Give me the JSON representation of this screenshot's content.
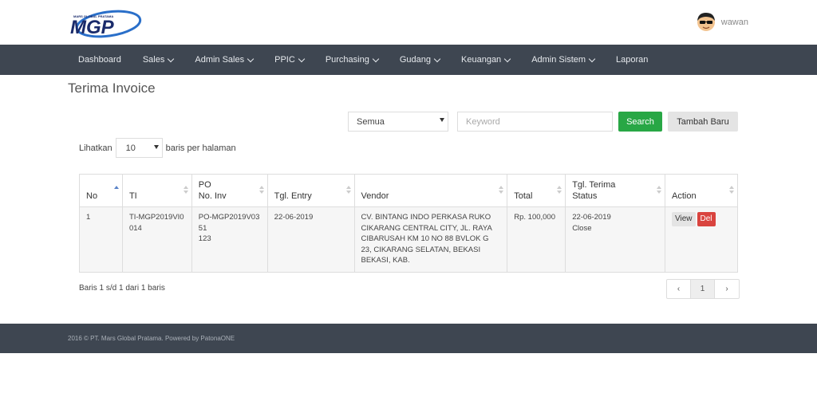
{
  "header": {
    "user_name": "wawan"
  },
  "nav": {
    "items": [
      {
        "label": "Dashboard",
        "dropdown": false
      },
      {
        "label": "Sales",
        "dropdown": true
      },
      {
        "label": "Admin Sales",
        "dropdown": true
      },
      {
        "label": "PPIC",
        "dropdown": true
      },
      {
        "label": "Purchasing",
        "dropdown": true
      },
      {
        "label": "Gudang",
        "dropdown": true
      },
      {
        "label": "Keuangan",
        "dropdown": true
      },
      {
        "label": "Admin Sistem",
        "dropdown": true
      },
      {
        "label": "Laporan",
        "dropdown": false
      }
    ]
  },
  "page": {
    "title": "Terima Invoice"
  },
  "filter": {
    "status_value": "Semua",
    "keyword_placeholder": "Keyword",
    "search_label": "Search",
    "add_label": "Tambah Baru"
  },
  "perpage": {
    "prefix": "Lihatkan",
    "value": "10",
    "suffix": "baris per halaman"
  },
  "table": {
    "columns": [
      {
        "label": "No",
        "sort_active": true
      },
      {
        "label": "TI"
      },
      {
        "label": "PO\nNo. Inv"
      },
      {
        "label": "Tgl. Entry"
      },
      {
        "label": "Vendor"
      },
      {
        "label": "Total"
      },
      {
        "label": "Tgl. Terima\nStatus"
      },
      {
        "label": "Action"
      }
    ],
    "rows": [
      {
        "no": "1",
        "ti": "TI-MGP2019VI0014",
        "po": "PO-MGP2019V0351",
        "inv": "123",
        "tgl_entry": "22-06-2019",
        "vendor": "CV. BINTANG INDO PERKASA RUKO CIKARANG CENTRAL CITY, JL. RAYA CIBARUSAH KM 10 NO 88 BVLOK G 23, CIKARANG SELATAN, BEKASI BEKASI, KAB.",
        "total": "Rp. 100,000",
        "tgl_terima": "22-06-2019",
        "status": "Close",
        "view_label": "View",
        "del_label": "Del"
      }
    ]
  },
  "info_text": "Baris 1 s/d 1 dari 1 baris",
  "pager": {
    "prev": "‹",
    "current": "1",
    "next": "›"
  },
  "footer": {
    "text": "2016 © PT. Mars Global Pratama. Powered by PatonaONE"
  },
  "logo": {
    "text": "MGP",
    "small_text": "MARS GLOBAL PRATAMA",
    "color": "#1a2b6b",
    "accent": "#2a6fc9"
  },
  "colors": {
    "nav_bg": "#3e4651",
    "success": "#28a745",
    "danger": "#d9443f"
  }
}
